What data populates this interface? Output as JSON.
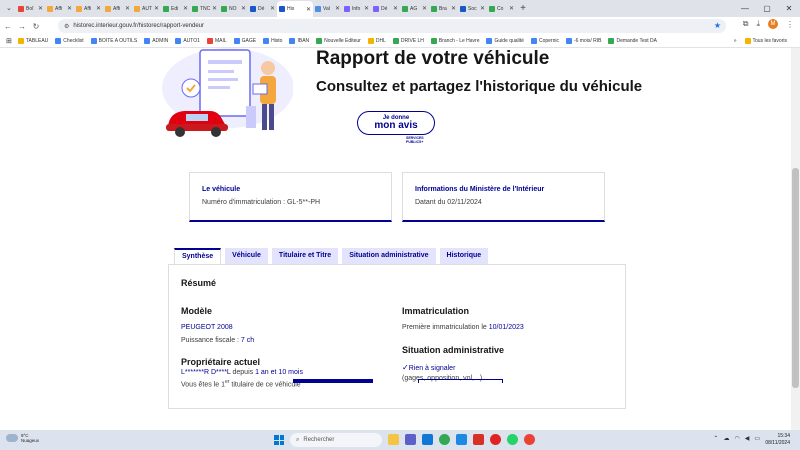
{
  "browser": {
    "tabs": [
      {
        "label": "Boî",
        "color": "#ea4335",
        "active": false
      },
      {
        "label": "Affi",
        "color": "#f4a73c",
        "active": false
      },
      {
        "label": "Affi",
        "color": "#f4a73c",
        "active": false
      },
      {
        "label": "Affi",
        "color": "#f4a73c",
        "active": false
      },
      {
        "label": "AUT",
        "color": "#f4a73c",
        "active": false
      },
      {
        "label": "Édi",
        "color": "#34a853",
        "active": false
      },
      {
        "label": "TNC",
        "color": "#34a853",
        "active": false
      },
      {
        "label": "NO",
        "color": "#34a853",
        "active": false
      },
      {
        "label": "Dé",
        "color": "#1a56c8",
        "active": false
      },
      {
        "label": "His",
        "color": "#1a56c8",
        "active": true
      },
      {
        "label": "Val",
        "color": "#4e8fe0",
        "active": false
      },
      {
        "label": "Info",
        "color": "#7b61ff",
        "active": false
      },
      {
        "label": "Dé",
        "color": "#7b61ff",
        "active": false
      },
      {
        "label": "AG",
        "color": "#34a853",
        "active": false
      },
      {
        "label": "Bra",
        "color": "#34a853",
        "active": false
      },
      {
        "label": "Soc",
        "color": "#1a56c8",
        "active": false
      },
      {
        "label": "Co",
        "color": "#34a853",
        "active": false
      }
    ],
    "new_tab": "+",
    "url": "historec.interieur.gouv.fr/historec/rapport-vendeur",
    "profile_initial": "M",
    "bookmarks": [
      {
        "label": "TABLEAU",
        "color": "#f4b400"
      },
      {
        "label": "Checklist",
        "color": "#4285f4"
      },
      {
        "label": "BOITE A OUTILS",
        "color": "#4285f4"
      },
      {
        "label": "ADMIN",
        "color": "#4285f4"
      },
      {
        "label": "AUTO1",
        "color": "#4285f4"
      },
      {
        "label": "MAIL",
        "color": "#ea4335"
      },
      {
        "label": "GAGE",
        "color": "#4285f4"
      },
      {
        "label": "Histo",
        "color": "#4285f4"
      },
      {
        "label": "IBAN",
        "color": "#4285f4"
      },
      {
        "label": "Nouvelle Editeur",
        "color": "#34a853"
      },
      {
        "label": "DHL",
        "color": "#f4b400"
      },
      {
        "label": "DRIVE LH",
        "color": "#34a853"
      },
      {
        "label": "Branch - Le Havre",
        "color": "#34a853"
      },
      {
        "label": "Guide qualité",
        "color": "#4285f4"
      },
      {
        "label": "Copernic",
        "color": "#4285f4"
      },
      {
        "label": "-6 mois/ RIB",
        "color": "#4285f4"
      },
      {
        "label": "Demande Test DA",
        "color": "#34a853"
      }
    ],
    "all_bookmarks": "Tous les favoris"
  },
  "hero": {
    "title": "Rapport de votre véhicule",
    "subtitle": "Consultez et partagez l'historique du véhicule",
    "feedback_line1": "Je donne",
    "feedback_line2": "mon avis",
    "sp_line1": "SERVICES",
    "sp_line2": "PUBLICS+"
  },
  "cards": {
    "vehicle_title": "Le véhicule",
    "vehicle_value": "Numéro d'immatriculation : GL-5**-PH",
    "ministry_title": "Informations du Ministère de l'Intérieur",
    "ministry_value": "Datant du 02/11/2024"
  },
  "tabs": [
    "Synthèse",
    "Véhicule",
    "Titulaire et Titre",
    "Situation administrative",
    "Historique"
  ],
  "summary": {
    "title": "Résumé",
    "model_title": "Modèle",
    "model_value": "PEUGEOT 2008",
    "power_label": "Puissance fiscale : ",
    "power_value": "7 ch",
    "owner_title": "Propriétaire actuel",
    "owner_name": "L*******R D****L",
    "owner_since_label": " depuis ",
    "owner_since_value": "1 an et 10 mois",
    "holder_prefix": "Vous êtes le ",
    "holder_rank": "1",
    "holder_sup": "er",
    "holder_suffix": " titulaire de ce véhicule",
    "immat_title": "Immatriculation",
    "immat_label": "Première immatriculation le ",
    "immat_value": "10/01/2023",
    "admin_title": "Situation administrative",
    "admin_value": "Rien à signaler",
    "admin_note": "(gages, opposition, vol,...)"
  },
  "taskbar": {
    "temp": "9°C",
    "weather": "Nuageux",
    "search": "Rechercher",
    "time": "15:34",
    "date": "08/11/2024"
  }
}
